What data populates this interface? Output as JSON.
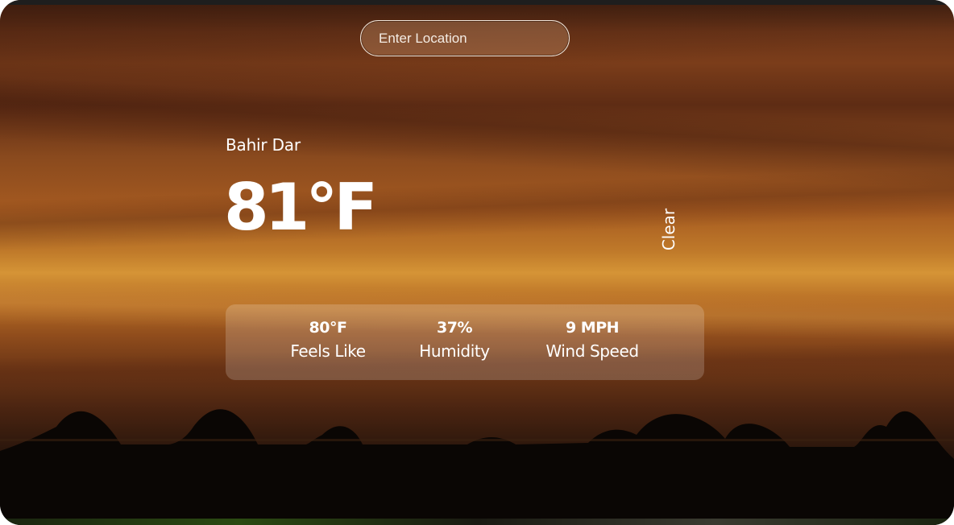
{
  "search": {
    "placeholder": "Enter Location",
    "value": ""
  },
  "weather": {
    "location": "Bahir Dar",
    "temperature": "81°F",
    "condition": "Clear"
  },
  "stats": [
    {
      "value": "80°F",
      "label": "Feels Like"
    },
    {
      "value": "37%",
      "label": "Humidity"
    },
    {
      "value": "9 MPH",
      "label": "Wind Speed"
    }
  ],
  "colors": {
    "text": "#ffffff",
    "search_border": "#f2e6da",
    "sky_orange": "#c07a2a",
    "sky_dark": "#3b1e10"
  }
}
